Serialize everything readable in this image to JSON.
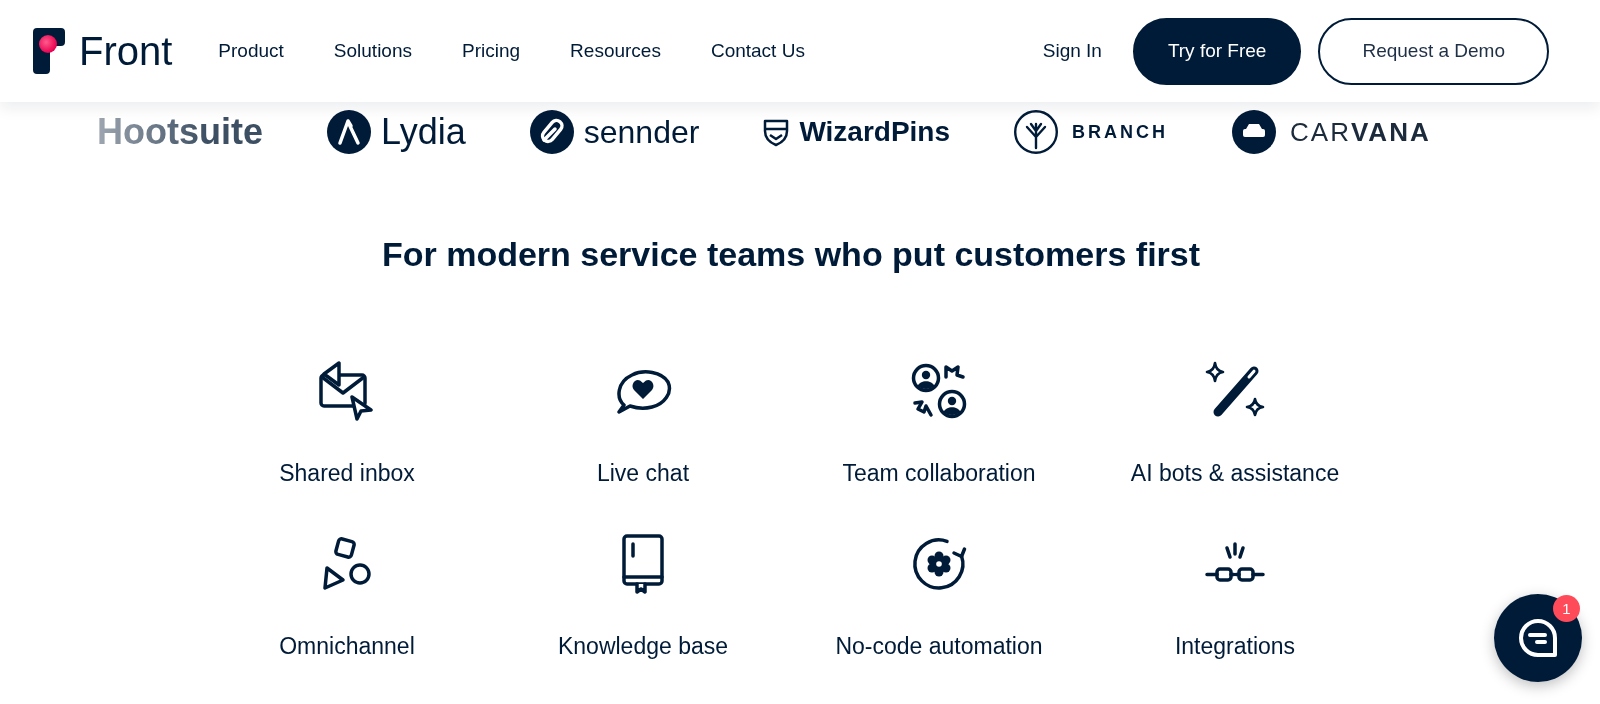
{
  "header": {
    "brand": "Front",
    "nav": [
      "Product",
      "Solutions",
      "Pricing",
      "Resources",
      "Contact Us"
    ],
    "sign_in": "Sign In",
    "primary_button": "Try for Free",
    "secondary_button": "Request a Demo"
  },
  "customer_logos": [
    {
      "name": "Hootsuite"
    },
    {
      "name": "Lydia"
    },
    {
      "name": "sennder"
    },
    {
      "name": "WizardPins"
    },
    {
      "name": "BRANCH"
    },
    {
      "name": "CAR**VANA**"
    }
  ],
  "heading": "For modern service teams who put customers first",
  "features": [
    {
      "label": "Shared inbox"
    },
    {
      "label": "Live chat"
    },
    {
      "label": "Team collaboration"
    },
    {
      "label": "AI bots & assistance"
    },
    {
      "label": "Omnichannel"
    },
    {
      "label": "Knowledge base"
    },
    {
      "label": "No-code automation"
    },
    {
      "label": "Integrations"
    }
  ],
  "chat_launcher": {
    "badge": "1"
  }
}
